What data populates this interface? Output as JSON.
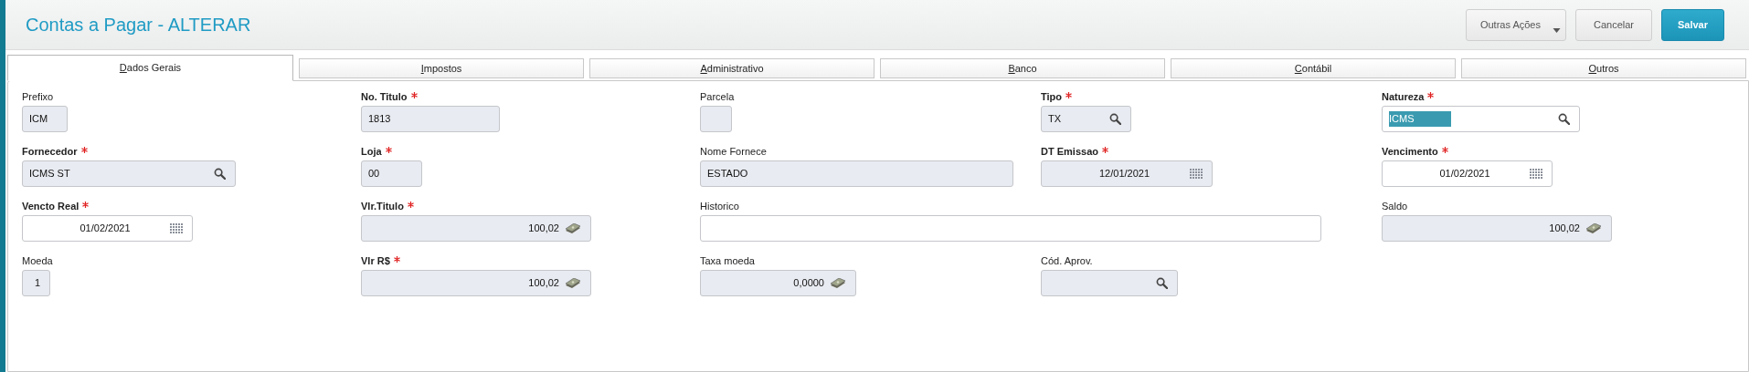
{
  "header": {
    "title": "Contas a Pagar - ALTERAR",
    "buttons": [
      {
        "label": "Outras Ações",
        "kind": "dropdown"
      },
      {
        "label": "Cancelar",
        "kind": "default"
      },
      {
        "label": "Salvar",
        "kind": "primary"
      }
    ]
  },
  "tabs": [
    {
      "label": "Dados Gerais",
      "selected": true
    },
    {
      "label": "Impostos",
      "selected": false
    },
    {
      "label": "Administrativo",
      "selected": false
    },
    {
      "label": "Banco",
      "selected": false
    },
    {
      "label": "Contábil",
      "selected": false
    },
    {
      "label": "Outros",
      "selected": false
    }
  ],
  "form": {
    "rows": [
      [
        {
          "label": "Prefixo",
          "required": false,
          "kind": "text",
          "value": "ICM",
          "editable": false
        },
        {
          "label": "No. Titulo",
          "required": true,
          "kind": "text",
          "value": "1813",
          "editable": false
        },
        {
          "label": "Parcela",
          "required": false,
          "kind": "text",
          "editable": false
        },
        {
          "label": "Tipo",
          "required": true,
          "kind": "lookup",
          "value": "TX",
          "editable": false
        },
        {
          "label": "Natureza",
          "required": true,
          "kind": "lookup",
          "value": "ICMS",
          "editable": true,
          "text_selected": true
        }
      ],
      [
        {
          "label": "Fornecedor",
          "required": true,
          "kind": "lookup",
          "value": "ICMS ST",
          "editable": false
        },
        {
          "label": "Loja",
          "required": true,
          "kind": "text",
          "value": "00",
          "editable": false
        },
        {
          "label": "Nome Fornece",
          "required": false,
          "kind": "text",
          "value": "ESTADO",
          "editable": false
        },
        {
          "label": "DT Emissao",
          "required": true,
          "kind": "date",
          "value": "12/01/2021",
          "editable": false
        },
        {
          "label": "Vencimento",
          "required": true,
          "kind": "date",
          "value": "01/02/2021",
          "editable": true
        }
      ],
      [
        {
          "label": "Vencto Real",
          "required": true,
          "kind": "date",
          "value": "01/02/2021",
          "editable": true
        },
        {
          "label": "Vlr.Titulo",
          "required": true,
          "kind": "currency",
          "value": "100,02",
          "editable": false
        },
        {
          "label": "Historico",
          "required": false,
          "kind": "text",
          "editable": true
        },
        "",
        {
          "label": "Saldo",
          "required": false,
          "kind": "currency",
          "value": "100,02",
          "editable": false
        }
      ],
      [
        {
          "label": "Moeda",
          "required": false,
          "kind": "number",
          "value": "1",
          "editable": false
        },
        {
          "label": "Vlr R$",
          "required": true,
          "kind": "currency",
          "value": "100,02",
          "editable": false
        },
        {
          "label": "Taxa moeda",
          "required": false,
          "kind": "currency",
          "value": "0,0000",
          "editable": false
        },
        {
          "label": "Cód. Aprov.",
          "required": false,
          "kind": "lookup",
          "editable": false
        }
      ]
    ]
  }
}
